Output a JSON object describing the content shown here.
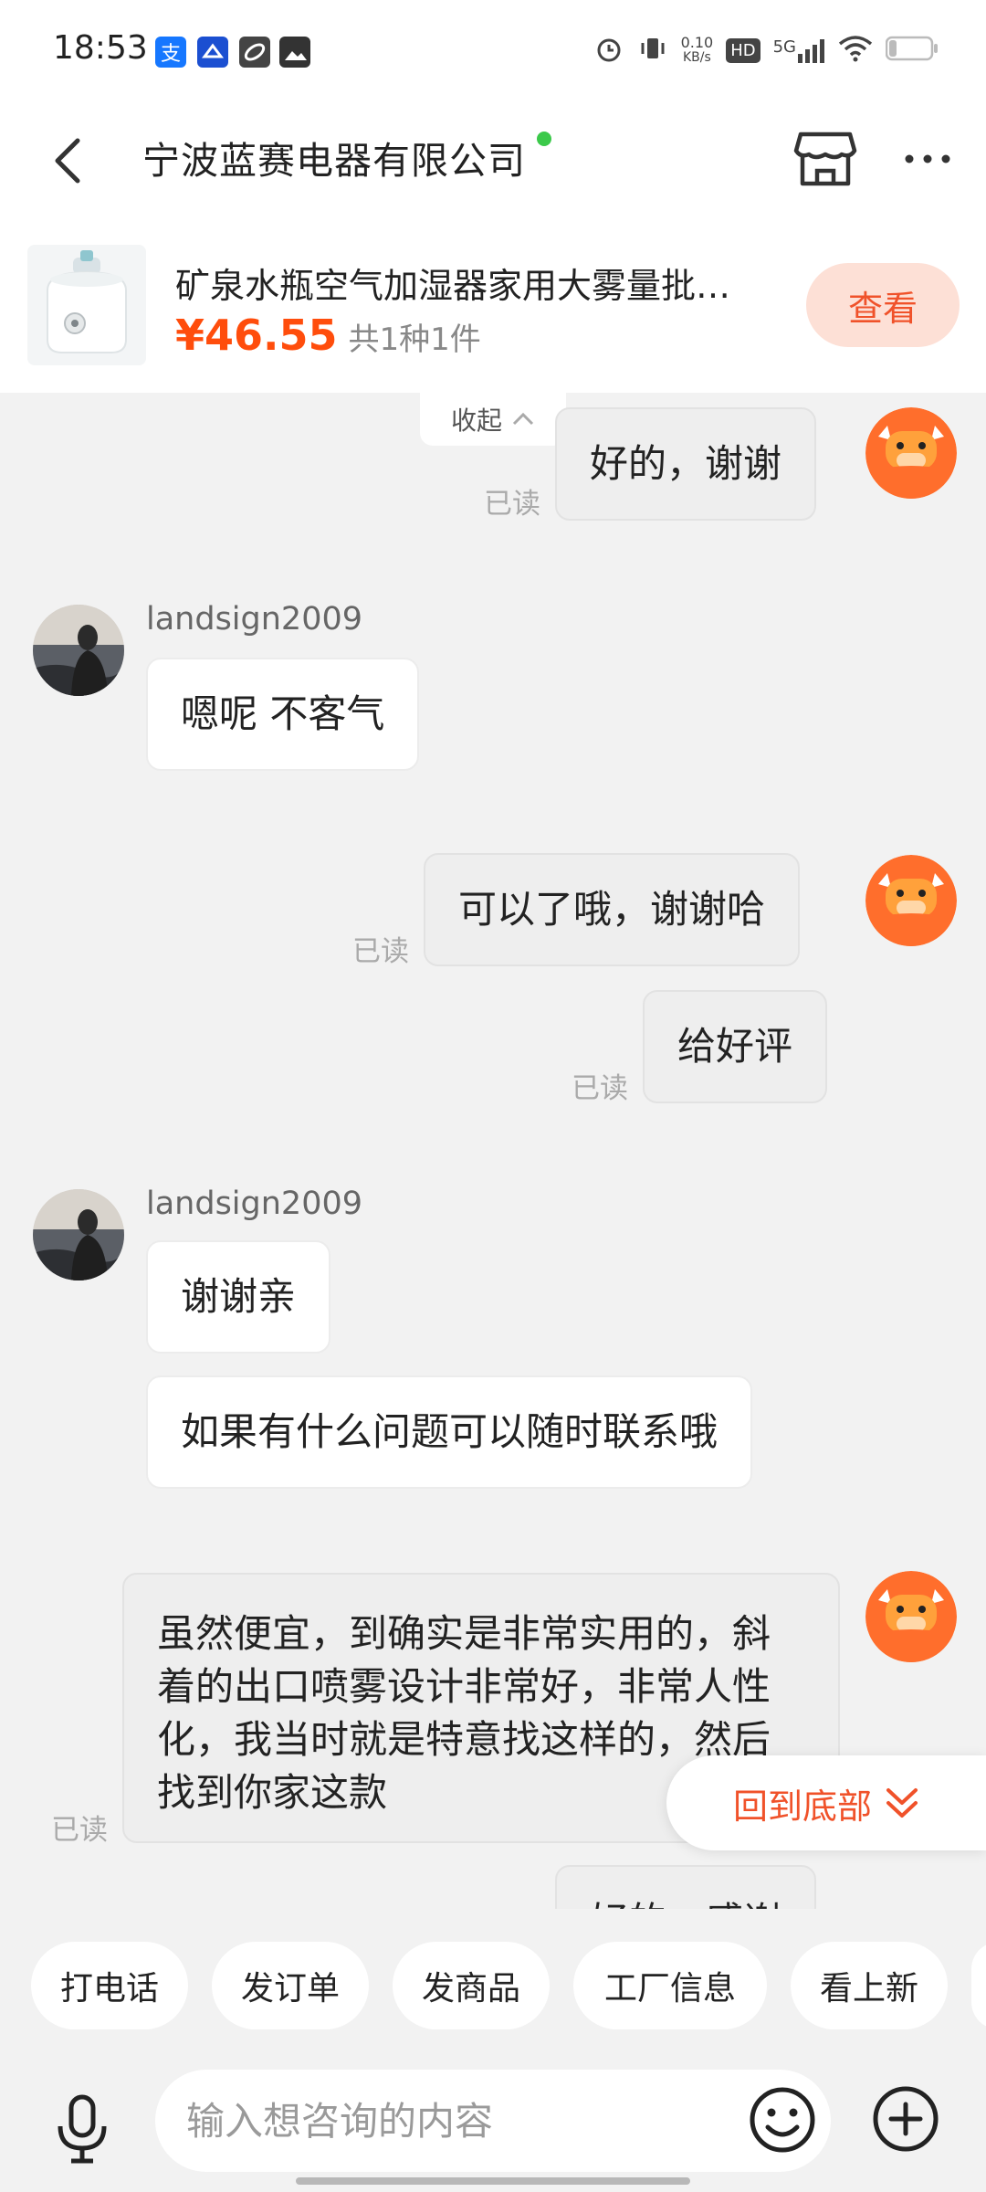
{
  "status_bar": {
    "time": "18:53",
    "net_speed_value": "0.10",
    "net_speed_unit": "KB/s",
    "hd_label": "HD",
    "network": "5G",
    "app_icons": [
      "alipay-icon",
      "app-icon",
      "link-app-icon",
      "gallery-app-icon"
    ],
    "right_icons": [
      "alarm-icon",
      "vibrate-icon",
      "signal-icon",
      "wifi-icon",
      "battery-icon"
    ]
  },
  "header": {
    "title": "宁波蓝赛电器有限公司",
    "online": true
  },
  "product": {
    "title": "矿泉水瓶空气加湿器家用大雾量批…",
    "price": "¥46.55",
    "quantity": "共1种1件",
    "view_label": "查看"
  },
  "chat": {
    "collapse_label": "收起",
    "read_label": "已读",
    "messages": [
      {
        "side": "out",
        "text": "好的，谢谢",
        "read": true
      },
      {
        "side": "in",
        "sender": "landsign2009",
        "text": "嗯呢 不客气"
      },
      {
        "side": "out",
        "text": "可以了哦，谢谢哈",
        "read": true
      },
      {
        "side": "out",
        "text": "给好评",
        "read": true
      },
      {
        "side": "in",
        "sender": "landsign2009",
        "text": "谢谢亲"
      },
      {
        "side": "in",
        "text": "如果有什么问题可以随时联系哦"
      },
      {
        "side": "out",
        "text": "虽然便宜，到确实是非常实用的，斜着的出口喷雾设计非常好，非常人性化，我当时就是特意找这样的，然后找到你家这款",
        "read": true
      },
      {
        "side": "out",
        "text": "好的，感谢"
      }
    ]
  },
  "back_to_bottom_label": "回到底部",
  "quick_actions": [
    "打电话",
    "发订单",
    "发商品",
    "工厂信息",
    "看上新"
  ],
  "input": {
    "placeholder": "输入想咨询的内容"
  },
  "colors": {
    "accent": "#f0522a",
    "price": "#ff4d0c",
    "online": "#3bc94a",
    "chat_bg": "#f2f2f2"
  }
}
